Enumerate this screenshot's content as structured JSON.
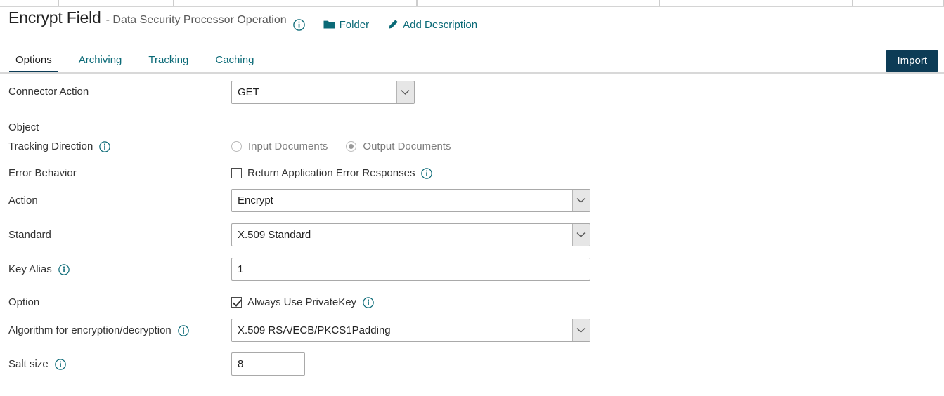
{
  "header": {
    "title": "Encrypt Field",
    "subtitle": "- Data Security Processor Operation",
    "info_icon": "info-icon",
    "folder_link": "Folder",
    "folder_icon": "folder-icon",
    "description_link": "Add Description",
    "description_icon": "pencil-icon"
  },
  "tabs": [
    {
      "label": "Options",
      "active": true
    },
    {
      "label": "Archiving",
      "active": false
    },
    {
      "label": "Tracking",
      "active": false
    },
    {
      "label": "Caching",
      "active": false
    }
  ],
  "toolbar": {
    "import_label": "Import"
  },
  "form": {
    "connector_action": {
      "label": "Connector Action",
      "value": "GET"
    },
    "object": {
      "label": "Object"
    },
    "tracking_direction": {
      "label": "Tracking Direction",
      "info_icon": "info-icon",
      "options": [
        {
          "label": "Input Documents",
          "selected": false
        },
        {
          "label": "Output Documents",
          "selected": true
        }
      ]
    },
    "error_behavior": {
      "label": "Error Behavior",
      "checkbox_label": "Return Application Error Responses",
      "checked": false,
      "info_icon": "info-icon"
    },
    "action": {
      "label": "Action",
      "value": "Encrypt"
    },
    "standard": {
      "label": "Standard",
      "value": "X.509 Standard"
    },
    "key_alias": {
      "label": "Key Alias",
      "value": "1",
      "info_icon": "info-icon"
    },
    "option": {
      "label": "Option",
      "checkbox_label": "Always Use PrivateKey",
      "checked": true,
      "info_icon": "info-icon"
    },
    "algorithm": {
      "label": "Algorithm for encryption/decryption",
      "value": "X.509 RSA/ECB/PKCS1Padding",
      "info_icon": "info-icon"
    },
    "salt_size": {
      "label": "Salt size",
      "value": "8",
      "info_icon": "info-icon"
    }
  },
  "colors": {
    "accent_teal": "#0b6a77",
    "navy": "#0d3c56",
    "text": "#333333",
    "muted": "#7d7d7d"
  }
}
